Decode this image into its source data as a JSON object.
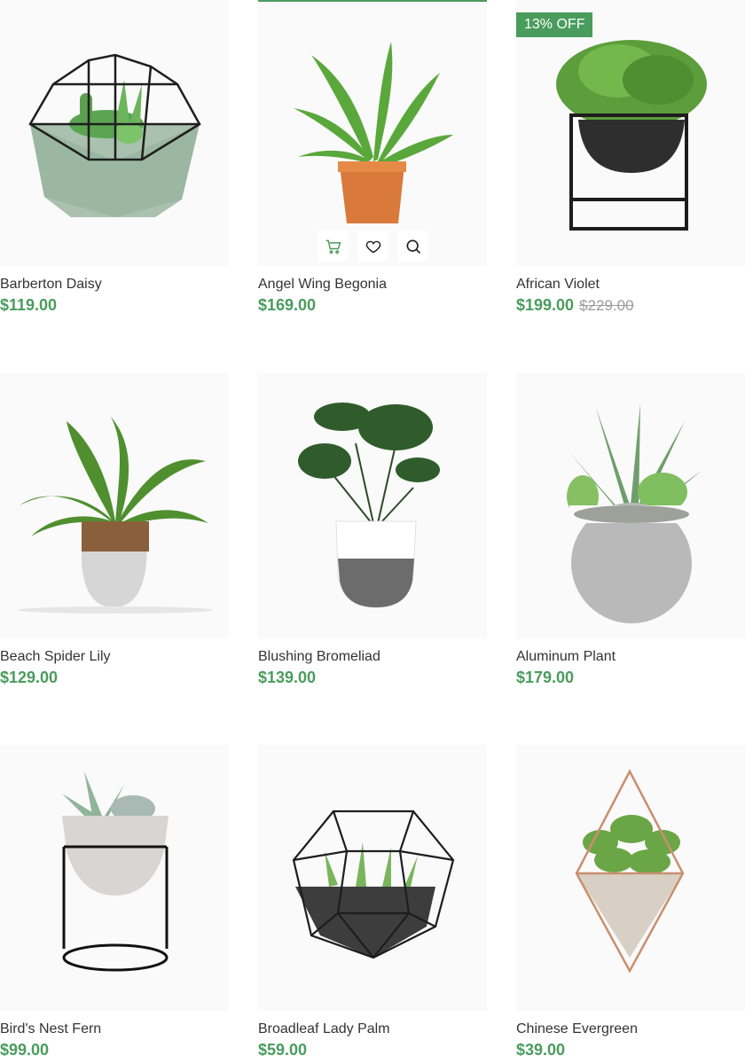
{
  "colors": {
    "accent": "#4a9c5d",
    "muted": "#9b9b9b",
    "text": "#333333"
  },
  "products": [
    {
      "name": "Barberton Daisy",
      "price": "$119.00",
      "image": "geometric-terrarium-planter"
    },
    {
      "name": "Angel Wing Begonia",
      "price": "$169.00",
      "image": "fern-terracotta-pot",
      "hover_actions": [
        {
          "icon": "cart-icon"
        },
        {
          "icon": "heart-icon"
        },
        {
          "icon": "search-icon"
        }
      ]
    },
    {
      "name": "African Violet",
      "price": "$199.00",
      "old_price": "$229.00",
      "badge": "13% OFF",
      "image": "bowl-planter-metal-stand"
    },
    {
      "name": "Beach Spider Lily",
      "price": "$129.00",
      "image": "leafy-plant-concrete-pot"
    },
    {
      "name": "Blushing Bromeliad",
      "price": "$139.00",
      "image": "monstera-white-grey-pot"
    },
    {
      "name": "Aluminum Plant",
      "price": "$179.00",
      "image": "succulents-round-concrete-pot"
    },
    {
      "name": "Bird's Nest Fern",
      "price": "$99.00",
      "image": "succulents-bowl-wire-stand"
    },
    {
      "name": "Broadleaf Lady Palm",
      "price": "$59.00",
      "image": "glass-dodecahedron-terrarium"
    },
    {
      "name": "Chinese Evergreen",
      "price": "$39.00",
      "image": "hanging-copper-planter"
    }
  ]
}
